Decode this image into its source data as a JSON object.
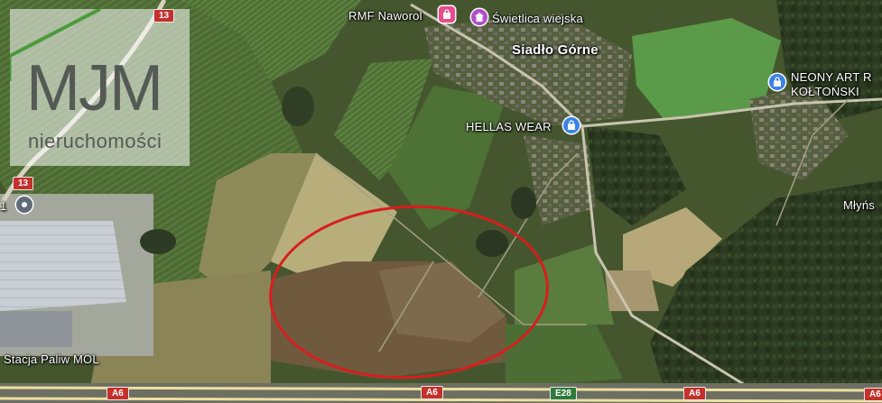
{
  "logo": {
    "main_text": "MJM",
    "sub_text": "nieruchomości"
  },
  "places": [
    {
      "name": "Siadło Górne",
      "kind": "town"
    },
    {
      "name": "RMF Naworol",
      "kind": "shop",
      "icon": "shopping-bag-icon",
      "color": "#e84c8b"
    },
    {
      "name": "Świetlica wiejska",
      "kind": "community",
      "icon": "community-hall-icon",
      "color": "#b04fc9"
    },
    {
      "name": "HELLAS WEAR",
      "kind": "shop",
      "icon": "shopping-bag-icon",
      "color": "#3b82e6"
    },
    {
      "name": "NEONY ART R",
      "kind": "shop",
      "icon": "shopping-bag-icon",
      "color": "#3b82e6"
    },
    {
      "name": "KOŁTOŃSKI",
      "kind": "shop-line2"
    },
    {
      "name": "Młyńs",
      "kind": "area"
    },
    {
      "name": "Stacja Paliw MOL",
      "kind": "fuel",
      "icon": "location-pin-icon",
      "color": "#5f6b78"
    }
  ],
  "roads": [
    {
      "ref": "13",
      "type": "national"
    },
    {
      "ref": "13",
      "type": "national"
    },
    {
      "ref": "A6",
      "type": "motorway"
    },
    {
      "ref": "A6",
      "type": "motorway"
    },
    {
      "ref": "A6",
      "type": "motorway"
    },
    {
      "ref": "A6",
      "type": "motorway"
    },
    {
      "ref": "E28",
      "type": "european"
    }
  ],
  "cut_label": "1",
  "colors": {
    "highlight": "#d81d1d",
    "shop_pin": "#3b82e6",
    "pink_pin": "#e84c8b",
    "purple_pin": "#b04fc9"
  }
}
